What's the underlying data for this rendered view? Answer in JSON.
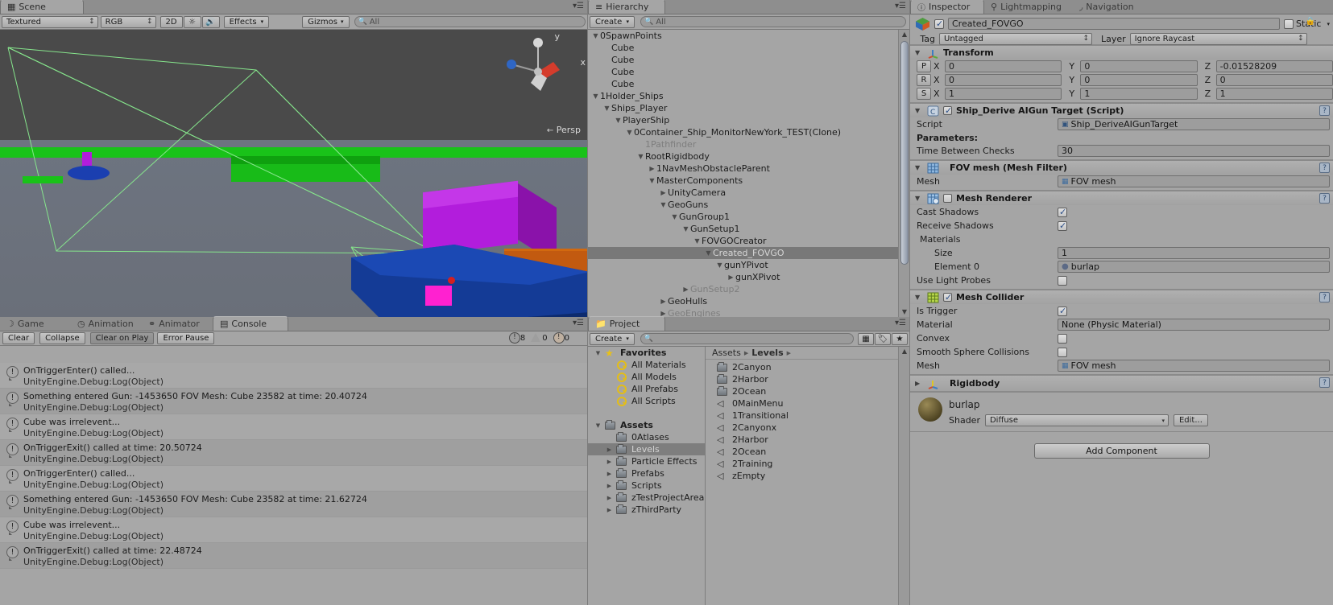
{
  "scene": {
    "tab_label": "Scene",
    "tab_icon": "grid-icon",
    "toolbar": {
      "draw_mode": "Textured",
      "color_mode": "RGB",
      "twod_label": "2D",
      "light_icon": "sun-icon",
      "audio_icon": "speaker-icon",
      "effects_label": "Effects",
      "gizmos_label": "Gizmos",
      "search_placeholder": "All"
    },
    "persp_label": "Persp",
    "gizmo_y_label": "y",
    "gizmo_x_label": "x"
  },
  "hierarchy": {
    "tab_label": "Hierarchy",
    "tab_icon": "list-icon",
    "create_label": "Create",
    "search_placeholder": "All",
    "rows": [
      {
        "label": "0SpawnPoints",
        "indent": 0,
        "tri": "down",
        "dim": false,
        "selected": false
      },
      {
        "label": "Cube",
        "indent": 1,
        "tri": "none",
        "dim": false,
        "selected": false
      },
      {
        "label": "Cube",
        "indent": 1,
        "tri": "none",
        "dim": false,
        "selected": false
      },
      {
        "label": "Cube",
        "indent": 1,
        "tri": "none",
        "dim": false,
        "selected": false
      },
      {
        "label": "Cube",
        "indent": 1,
        "tri": "none",
        "dim": false,
        "selected": false
      },
      {
        "label": "1Holder_Ships",
        "indent": 0,
        "tri": "down",
        "dim": false,
        "selected": false
      },
      {
        "label": "Ships_Player",
        "indent": 1,
        "tri": "down",
        "dim": false,
        "selected": false
      },
      {
        "label": "PlayerShip",
        "indent": 2,
        "tri": "down",
        "dim": false,
        "selected": false
      },
      {
        "label": "0Container_Ship_MonitorNewYork_TEST(Clone)",
        "indent": 3,
        "tri": "down",
        "dim": false,
        "selected": false
      },
      {
        "label": "1Pathfinder",
        "indent": 4,
        "tri": "none",
        "dim": true,
        "selected": false
      },
      {
        "label": "RootRigidbody",
        "indent": 4,
        "tri": "down",
        "dim": false,
        "selected": false
      },
      {
        "label": "1NavMeshObstacleParent",
        "indent": 5,
        "tri": "right",
        "dim": false,
        "selected": false
      },
      {
        "label": "MasterComponents",
        "indent": 5,
        "tri": "down",
        "dim": false,
        "selected": false
      },
      {
        "label": "UnityCamera",
        "indent": 6,
        "tri": "right",
        "dim": false,
        "selected": false
      },
      {
        "label": "GeoGuns",
        "indent": 6,
        "tri": "down",
        "dim": false,
        "selected": false
      },
      {
        "label": "GunGroup1",
        "indent": 7,
        "tri": "down",
        "dim": false,
        "selected": false
      },
      {
        "label": "GunSetup1",
        "indent": 8,
        "tri": "down",
        "dim": false,
        "selected": false
      },
      {
        "label": "FOVGOCreator",
        "indent": 9,
        "tri": "down",
        "dim": false,
        "selected": false
      },
      {
        "label": "Created_FOVGO",
        "indent": 10,
        "tri": "down",
        "dim": false,
        "selected": true
      },
      {
        "label": "gunYPivot",
        "indent": 11,
        "tri": "down",
        "dim": false,
        "selected": false
      },
      {
        "label": "gunXPivot",
        "indent": 12,
        "tri": "right",
        "dim": false,
        "selected": false
      },
      {
        "label": "GunSetup2",
        "indent": 8,
        "tri": "right",
        "dim": true,
        "selected": false
      },
      {
        "label": "GeoHulls",
        "indent": 6,
        "tri": "right",
        "dim": false,
        "selected": false
      },
      {
        "label": "GeoEngines",
        "indent": 6,
        "tri": "right",
        "dim": true,
        "selected": false
      }
    ]
  },
  "console": {
    "tabs": [
      {
        "label": "Game",
        "icon": "moon-icon",
        "active": false
      },
      {
        "label": "Animation",
        "icon": "clock-icon",
        "active": false
      },
      {
        "label": "Animator",
        "icon": "nodes-icon",
        "active": false
      },
      {
        "label": "Console",
        "icon": "console-icon",
        "active": true
      }
    ],
    "buttons": [
      {
        "label": "Clear",
        "pressed": false
      },
      {
        "label": "Collapse",
        "pressed": false
      },
      {
        "label": "Clear on Play",
        "pressed": true
      },
      {
        "label": "Error Pause",
        "pressed": false
      }
    ],
    "counts": {
      "info": "8",
      "warning": "0",
      "error": "0"
    },
    "logs": [
      {
        "line1": "OnTriggerEnter() called...",
        "line2": "UnityEngine.Debug:Log(Object)"
      },
      {
        "line1": "Something entered Gun: -1453650 FOV Mesh: Cube 23582 at time: 20.40724",
        "line2": "UnityEngine.Debug:Log(Object)"
      },
      {
        "line1": "Cube was irrelevent...",
        "line2": "UnityEngine.Debug:Log(Object)"
      },
      {
        "line1": "OnTriggerExit() called at time: 20.50724",
        "line2": "UnityEngine.Debug:Log(Object)"
      },
      {
        "line1": "OnTriggerEnter() called...",
        "line2": "UnityEngine.Debug:Log(Object)"
      },
      {
        "line1": "Something entered Gun: -1453650 FOV Mesh: Cube 23582 at time: 21.62724",
        "line2": "UnityEngine.Debug:Log(Object)"
      },
      {
        "line1": "Cube was irrelevent...",
        "line2": "UnityEngine.Debug:Log(Object)"
      },
      {
        "line1": "OnTriggerExit() called at time: 22.48724",
        "line2": "UnityEngine.Debug:Log(Object)"
      }
    ]
  },
  "project": {
    "tab_label": "Project",
    "tab_icon": "folder-icon",
    "create_label": "Create",
    "search_placeholder": "",
    "tree": [
      {
        "label": "Favorites",
        "indent": 0,
        "tri": "down",
        "icon": "star-icon",
        "bold": true,
        "selected": false
      },
      {
        "label": "All Materials",
        "indent": 1,
        "tri": "none",
        "icon": "magnifier-icon",
        "bold": false,
        "selected": false
      },
      {
        "label": "All Models",
        "indent": 1,
        "tri": "none",
        "icon": "magnifier-icon",
        "bold": false,
        "selected": false
      },
      {
        "label": "All Prefabs",
        "indent": 1,
        "tri": "none",
        "icon": "magnifier-icon",
        "bold": false,
        "selected": false
      },
      {
        "label": "All Scripts",
        "indent": 1,
        "tri": "none",
        "icon": "magnifier-icon",
        "bold": false,
        "selected": false
      },
      {
        "label": "",
        "indent": 0,
        "tri": "none",
        "icon": "none",
        "bold": false,
        "selected": false
      },
      {
        "label": "Assets",
        "indent": 0,
        "tri": "down",
        "icon": "folder-icon",
        "bold": true,
        "selected": false
      },
      {
        "label": "0Atlases",
        "indent": 1,
        "tri": "none",
        "icon": "folder-icon",
        "bold": false,
        "selected": false
      },
      {
        "label": "Levels",
        "indent": 1,
        "tri": "right",
        "icon": "folder-icon",
        "bold": false,
        "selected": true
      },
      {
        "label": "Particle Effects",
        "indent": 1,
        "tri": "right",
        "icon": "folder-icon",
        "bold": false,
        "selected": false
      },
      {
        "label": "Prefabs",
        "indent": 1,
        "tri": "right",
        "icon": "folder-icon",
        "bold": false,
        "selected": false
      },
      {
        "label": "Scripts",
        "indent": 1,
        "tri": "right",
        "icon": "folder-icon",
        "bold": false,
        "selected": false
      },
      {
        "label": "zTestProjectArea",
        "indent": 1,
        "tri": "right",
        "icon": "folder-icon",
        "bold": false,
        "selected": false
      },
      {
        "label": "zThirdParty",
        "indent": 1,
        "tri": "right",
        "icon": "folder-icon",
        "bold": false,
        "selected": false
      }
    ],
    "breadcrumb": {
      "root": "Assets",
      "current": "Levels"
    },
    "items": [
      {
        "label": "2Canyon",
        "icon": "folder-icon"
      },
      {
        "label": "2Harbor",
        "icon": "folder-icon"
      },
      {
        "label": "2Ocean",
        "icon": "folder-icon"
      },
      {
        "label": "0MainMenu",
        "icon": "unity-scene-icon"
      },
      {
        "label": "1Transitional",
        "icon": "unity-scene-icon"
      },
      {
        "label": "2Canyonx",
        "icon": "unity-scene-icon"
      },
      {
        "label": "2Harbor",
        "icon": "unity-scene-icon"
      },
      {
        "label": "2Ocean",
        "icon": "unity-scene-icon"
      },
      {
        "label": "2Training",
        "icon": "unity-scene-icon"
      },
      {
        "label": "zEmpty",
        "icon": "unity-scene-icon"
      }
    ]
  },
  "inspector": {
    "tabs": [
      {
        "label": "Inspector",
        "icon": "info-icon",
        "active": true
      },
      {
        "label": "Lightmapping",
        "icon": "bulb-icon",
        "active": false
      },
      {
        "label": "Navigation",
        "icon": "navmesh-icon",
        "active": false
      }
    ],
    "object_name": "Created_FOVGO",
    "object_enabled": true,
    "static_label": "Static",
    "static_checked": false,
    "tag_label": "Tag",
    "tag_value": "Untagged",
    "layer_label": "Layer",
    "layer_value": "Ignore Raycast",
    "transform": {
      "title": "Transform",
      "rows": [
        {
          "btn": "P",
          "x_label": "X",
          "x": "0",
          "y_label": "Y",
          "y": "0",
          "z_label": "Z",
          "z": "-0.01528209"
        },
        {
          "btn": "R",
          "x_label": "X",
          "x": "0",
          "y_label": "Y",
          "y": "0",
          "z_label": "Z",
          "z": "0"
        },
        {
          "btn": "S",
          "x_label": "X",
          "x": "1",
          "y_label": "Y",
          "y": "1",
          "z_label": "Z",
          "z": "1"
        }
      ]
    },
    "script_comp": {
      "title": "Ship_Derive AIGun Target (Script)",
      "enabled": true,
      "script_label": "Script",
      "script_value": "Ship_DeriveAIGunTarget",
      "params_label": "Parameters:",
      "time_label": "Time Between Checks",
      "time_value": "30"
    },
    "mesh_filter": {
      "title": "FOV mesh (Mesh Filter)",
      "mesh_label": "Mesh",
      "mesh_value": "FOV mesh"
    },
    "mesh_renderer": {
      "title": "Mesh Renderer",
      "enabled": false,
      "cast_label": "Cast Shadows",
      "cast_checked": true,
      "receive_label": "Receive Shadows",
      "receive_checked": true,
      "materials_label": "Materials",
      "size_label": "Size",
      "size_value": "1",
      "element_label": "Element 0",
      "element_value": "burlap",
      "probes_label": "Use Light Probes",
      "probes_checked": false
    },
    "mesh_collider": {
      "title": "Mesh Collider",
      "enabled": true,
      "trigger_label": "Is Trigger",
      "trigger_checked": true,
      "material_label": "Material",
      "material_value": "None (Physic Material)",
      "convex_label": "Convex",
      "convex_checked": false,
      "smooth_label": "Smooth Sphere Collisions",
      "smooth_checked": false,
      "mesh_label": "Mesh",
      "mesh_value": "FOV mesh"
    },
    "rigidbody": {
      "title": "Rigidbody"
    },
    "material": {
      "name": "burlap",
      "shader_label": "Shader",
      "shader_value": "Diffuse",
      "edit_label": "Edit..."
    },
    "add_component_label": "Add Component"
  },
  "colors": {
    "panel_bg": "#a5a5a5",
    "selection": "#787878",
    "accent_green": "#19c219",
    "accent_purple": "#b21ddc",
    "accent_orange": "#c25a10",
    "accent_blue": "#123a8c",
    "accent_pink": "#ff21d0"
  }
}
